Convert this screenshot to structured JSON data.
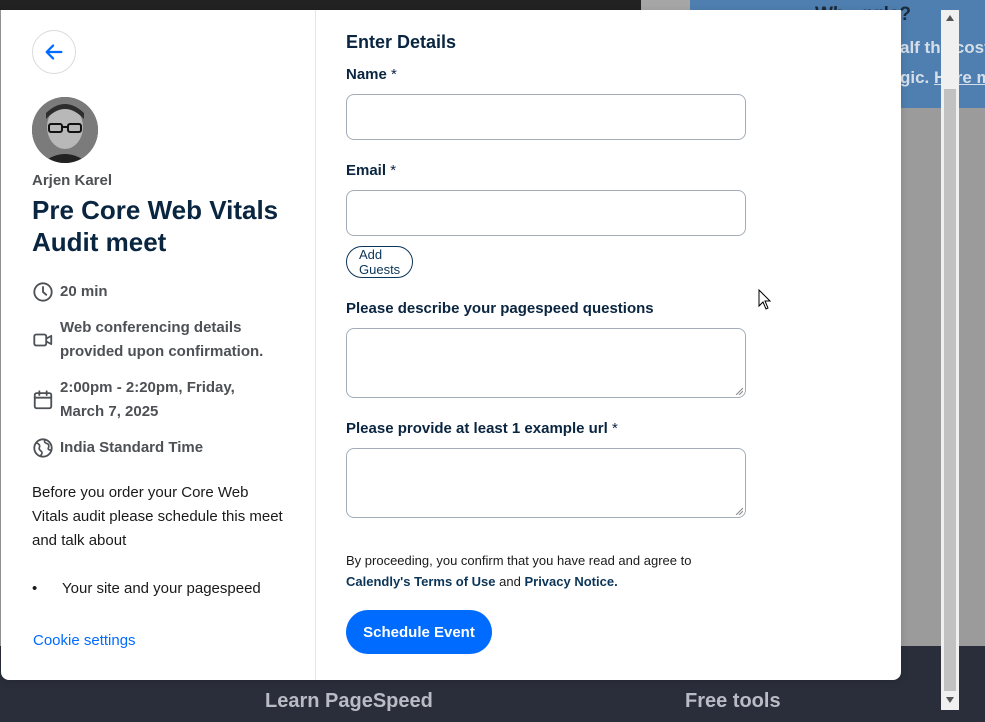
{
  "background": {
    "heading_fragment": "Wh...ggle?",
    "text_line1": "alf the cost",
    "text_line2_a": "gic.",
    "text_line2_link": "Here me",
    "footer_links": [
      "Learn PageSpeed",
      "Free tools"
    ]
  },
  "sidebar": {
    "host_name": "Arjen Karel",
    "event_title": "Pre Core Web Vitals Audit meet",
    "duration": "20 min",
    "location": "Web conferencing details provided upon confirmation.",
    "datetime": "2:00pm - 2:20pm, Friday, March 7, 2025",
    "timezone": "India Standard Time",
    "description": "Before you order your Core Web Vitals audit please schedule this meet and talk about",
    "bullet_marker": "•",
    "bullet_item": "Your site and your pagespeed",
    "cookie_settings": "Cookie settings"
  },
  "form": {
    "heading": "Enter Details",
    "name_label": "Name",
    "email_label": "Email",
    "required_mark": "*",
    "add_guests": "Add Guests",
    "question1_label": "Please describe your pagespeed questions",
    "question2_label": "Please provide at least 1 example url",
    "legal_text": "By proceeding, you confirm that you have read and agree to",
    "terms_link": "Calendly's Terms of Use",
    "legal_and": "and",
    "privacy_link": "Privacy Notice.",
    "submit": "Schedule Event"
  },
  "colors": {
    "accent": "#006bff",
    "navy": "#0a2540",
    "muted": "#4d5055"
  }
}
